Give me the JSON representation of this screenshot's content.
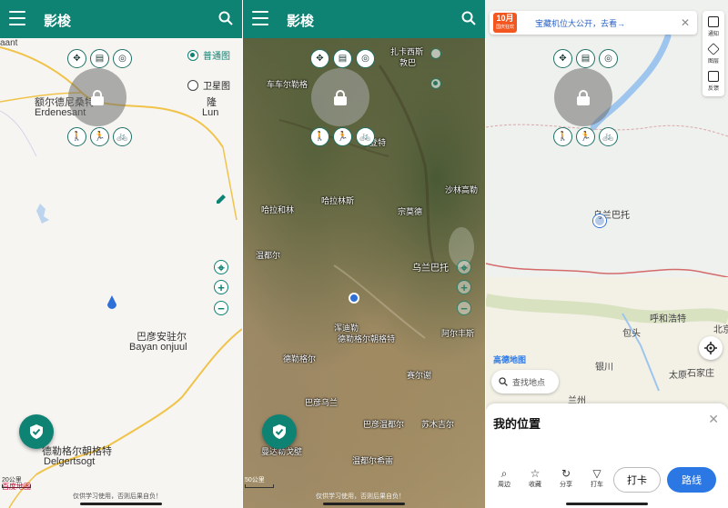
{
  "app": {
    "title": "影梭"
  },
  "tools": {
    "top": [
      "move-icon",
      "bookmark-list-icon",
      "location-pin-icon"
    ],
    "bottom": [
      "walk-icon",
      "run-icon",
      "bike-icon"
    ]
  },
  "panel1": {
    "layers": {
      "normal": "普通图",
      "satellite": "卫星图"
    },
    "labels": {
      "aant": "aant",
      "erdenesant_cn": "额尔德尼桑特",
      "erdenesant": "Erdenesant",
      "lun_cn": "隆",
      "lun": "Lun",
      "bayan_cn": "巴彦安驻尔",
      "bayan": "Bayan onjuul",
      "delgertsogt_cn": "德勒格尔朝格特",
      "delgertsogt": "Delgertsogt"
    },
    "scale": "20公里",
    "logo": "百度地图",
    "footnote": "仅供学习使用，否则后果自负！"
  },
  "panel2": {
    "labels": {
      "l1": "扎卡西斯",
      "l1b": "敦巴",
      "l2": "车车尔勒格",
      "l3": "尔登特",
      "l4": "沙林高勒",
      "l5": "哈拉林斯",
      "l6": "哈拉和林",
      "l7": "宗莫德",
      "l8": "乌兰巴托",
      "l9": "温都尔",
      "l10": "浑迪勒",
      "l11": "德勒格尔朝格特",
      "l12": "阿尔丰斯",
      "l13": "德勒格尔",
      "l14": "赛尔谢",
      "l15": "巴彦乌兰",
      "l16": "苏木吉尔",
      "l17": "巴彦温都尔",
      "l18": "曼达勒戈壁",
      "l19": "温都尔希雷"
    },
    "scale": "50公里",
    "footnote": "仅供学习使用，否则后果自负！"
  },
  "panel3": {
    "banner": {
      "badge": "10月",
      "badge_sub": "国庆狂欢",
      "text": "宝藏机位大公开，去看→"
    },
    "side_tools": [
      "通知",
      "图层",
      "反馈"
    ],
    "labels": {
      "ulaanbaatar": "乌兰巴托",
      "hohhot": "呼和浩特",
      "baotou": "包头",
      "beijing": "北京",
      "yinchuan": "银川",
      "taiyuan": "太原",
      "shijiazhuang": "石家庄",
      "lanzhou": "兰州"
    },
    "logo": "高德地图",
    "search_placeholder": "查找地点",
    "sheet": {
      "title": "我的位置",
      "actions": [
        "周边",
        "收藏",
        "分享",
        "打车"
      ],
      "checkin": "打卡",
      "route": "路线"
    }
  },
  "colors": {
    "primary": "#0e8373",
    "amap_blue": "#2b78e4"
  }
}
